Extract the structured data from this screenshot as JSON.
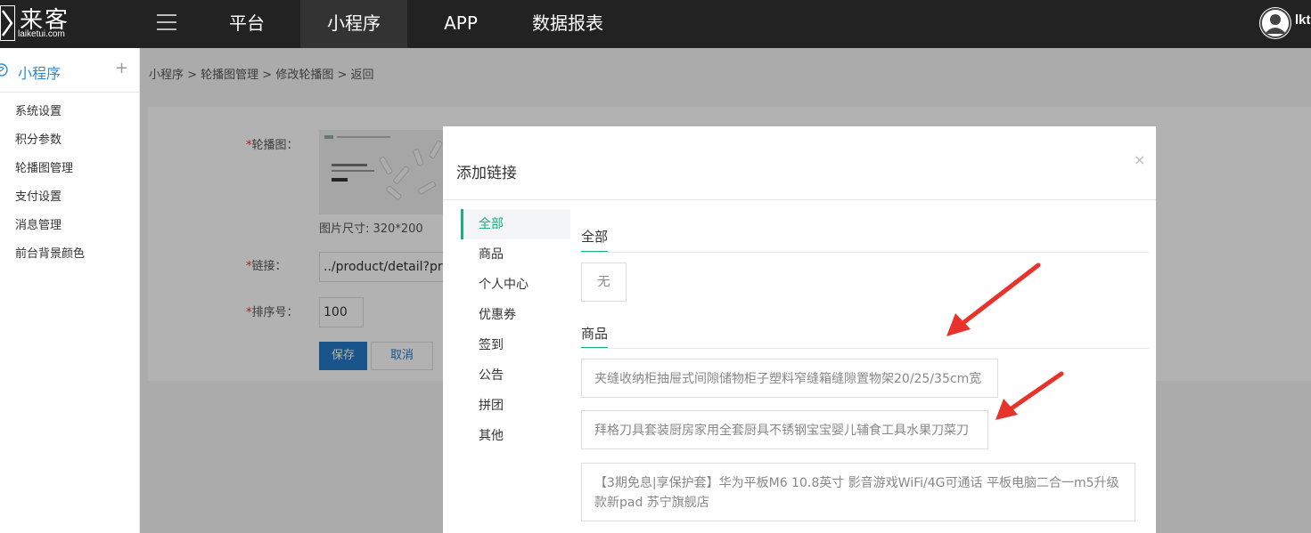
{
  "header": {
    "logo_text": "来客",
    "logo_sub": "laiketui.com",
    "nav": [
      "平台",
      "小程序",
      "APP",
      "数据报表"
    ],
    "active_nav": "小程序",
    "user": "lkt"
  },
  "sidebar": {
    "title": "小程序",
    "items": [
      "系统设置",
      "积分参数",
      "轮播图管理",
      "支付设置",
      "消息管理",
      "前台背景颜色"
    ]
  },
  "breadcrumb": "小程序  >  轮播图管理  >  修改轮播图  >  返回",
  "form": {
    "banner_label": "轮播图：",
    "image_size": "图片尺寸: 320*200",
    "link_label": "链接：",
    "link_value": "../product/detail?productId=",
    "sort_label": "排序号：",
    "sort_value": "100",
    "required_mark": "*",
    "save": "保存",
    "cancel": "取消"
  },
  "modal": {
    "title": "添加链接",
    "close": "×",
    "categories": [
      "全部",
      "商品",
      "个人中心",
      "优惠券",
      "签到",
      "公告",
      "拼团",
      "其他"
    ],
    "active_category": "全部",
    "sections": [
      {
        "title": "全部",
        "items": [
          "无"
        ]
      },
      {
        "title": "商品",
        "items": [
          "夹缝收纳柜抽屉式间隙储物柜子塑料窄缝箱缝隙置物架20/25/35cm宽",
          "拜格刀具套装厨房家用全套厨具不锈钢宝宝婴儿辅食工具水果刀菜刀",
          "【3期免息|享保护套】华为平板M6 10.8英寸 影音游戏WiFi/4G可通话 平板电脑二合一m5升级款新pad 苏宁旗舰店"
        ]
      }
    ]
  },
  "colors": {
    "accent_green": "#1aad7e",
    "primary_blue": "#2479c7",
    "top_bar": "#222222",
    "annotation_red": "#e8332b"
  }
}
